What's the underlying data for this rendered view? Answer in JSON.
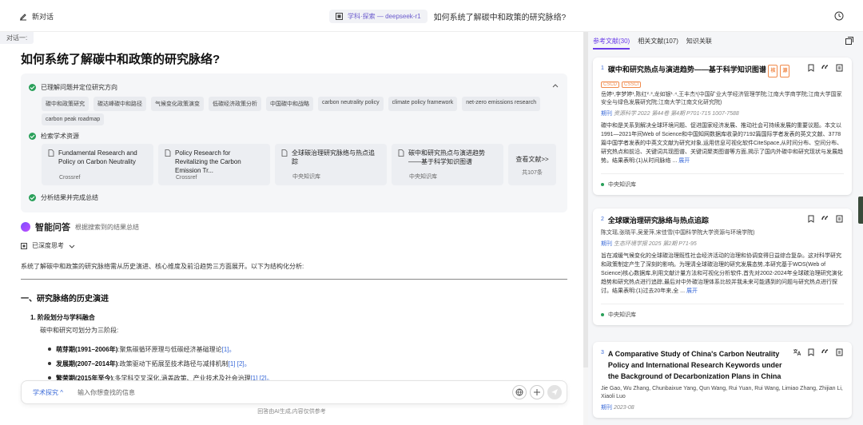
{
  "topbar": {
    "new_chat": "新对话",
    "model_label": "学科·探索 — deepseek-r1",
    "question": "如何系统了解碳中和政策的研究脉络?"
  },
  "main": {
    "turn_label": "对话一:",
    "title": "如何系统了解碳中和政策的研究脉络?",
    "steps": {
      "step1": "已理解问题并定位研究方向",
      "step2": "检索学术资源",
      "step3": "分析结果并完成总结"
    },
    "keywords_row1": [
      "碳中和政策研究",
      "碳达峰碳中和路径",
      "气候变化政策演变",
      "低碳经济政策分析",
      "中国碳中和战略",
      "carbon neutrality policy",
      "climate policy framework",
      "net-zero emissions research"
    ],
    "keywords_row2": [
      "carbon peak roadmap"
    ],
    "sources": [
      {
        "title": "Fundamental Research and Policy on Carbon Neutrality",
        "source": "Crossref"
      },
      {
        "title": "Policy Research for Revitalizing the Carbon Emission Tr...",
        "source": "Crossref"
      },
      {
        "title": "全球碳治理研究脉络与热点追踪",
        "source": "中央知识库"
      },
      {
        "title": "碳中和研究热点与演进趋势——基于科学知识图谱",
        "source": "中央知识库"
      }
    ],
    "more": {
      "label": "查看文献>>",
      "count": "共107条"
    },
    "answer": {
      "title": "智能问答",
      "subtitle": "根据搜索到的结果总结",
      "deep_thought": "已深度思考",
      "intro": "系统了解碳中和政策的研究脉络需从历史演进、核心维度及前沿趋势三方面展开。以下为结构化分析:",
      "h2": "一、研究脉络的历史演进",
      "h3": "1. 阶段划分与学科融合",
      "p1": "碳中和研究可划分为三阶段:",
      "bullets": [
        {
          "term": "萌芽期(1991–2006年)",
          "text": ":聚焦碳循环原理与低碳经济基础理论",
          "cite": "[1]。"
        },
        {
          "term": "发展期(2007–2014年)",
          "text": ":政策驱动下拓展至技术路径与减排机制",
          "cite": "[1] [2]。"
        },
        {
          "term": "繁荣期(2015年至今)",
          "text": ":多学科交叉深化,涵盖政策、产业技术及社会治理",
          "cite": "[1] [2]。"
        }
      ]
    },
    "input": {
      "mode": "学术探究",
      "placeholder": "输入你想查找的信息"
    },
    "footer": "回答由AI生成,内容仅供参考"
  },
  "panel": {
    "tabs": [
      "参考文献(30)",
      "相关文献(107)",
      "知识关联"
    ],
    "cards": [
      {
        "index": "1",
        "title": "碳中和研究热点与演进趋势——基于科学知识图谱",
        "tags": [
          "CSCD",
          "CSSCI"
        ],
        "inline_tags": [
          "核",
          "源"
        ],
        "authors": "岳婷¹,李梦婷¹,陈红²˒³,龙如银¹˒⁴,王丰杰¹(中国矿业大学经济管理学院;江南大学商学院;江南大学国家安全与绿色发展研究院;江南大学江南文化研究院)",
        "journal_label": "期刊",
        "journal": "资源科学 2022 第44卷 第4期 P701-715 1007-7588",
        "abstract": "碳中和是关系到解决全球环境问题、促进国家经济发展、推动社会可持续发展的重要议题。本文以1991—2021年间Web of Science和中国知网数据库收录的7192篇国际学者发表的英文文献、3778篇中国学者发表的中英文文献为研究对象,运用信息可视化软件CiteSpace,从时间分布、空间分布、研究热点和前沿、关键词共现图谱、关键词聚类图谱等方面,揭示了国内外碳中和研究现状与发展趋势。结果表明:(1)从时间脉络 ...",
        "expand": "展开",
        "source": "中央知识库"
      },
      {
        "index": "2",
        "title": "全球碳治理研究脉络与热点追踪",
        "authors": "陈文瑶,张晓平,吴爱萍,宋佳雪(中国科学院大学资源与环境学院)",
        "journal_label": "期刊",
        "journal": "生态环境学报 2025 第2期 P71-95",
        "abstract": "旨在减缓气候变化的全球碳治理既性社会经济活动的治理和协调变得日益综合复杂。这对科学研究和政策制定产生了深刻的影响。为理清全球碳治理的研究发展态势,本研究基于WOS(Web of Science)核心数据库,利用文献计量方法和可视化分析软件,首先对2002-2024年全球碳治理研究演化趋势和研究热点进行追踪,最后对中外碳治理体系比较并我未来可能遇到的问题与研究热点进行探讨。结果表明:(1)过去20年来,全 ...",
        "expand": "展开",
        "source": "中央知识库"
      },
      {
        "index": "3",
        "title": "A Comparative Study of China's Carbon Neutrality Policy and International Research Keywords under the Background of Decarbonization Plans in China",
        "authors": "Jie Gao, Wu Zhang, Chunbaixue Yang, Qun Wang, Rui Yuan, Rui Wang, Limiao Zhang, Zhijian Li, Xiaoli Luo",
        "journal_label": "期刊",
        "journal": "2023-08"
      }
    ]
  }
}
